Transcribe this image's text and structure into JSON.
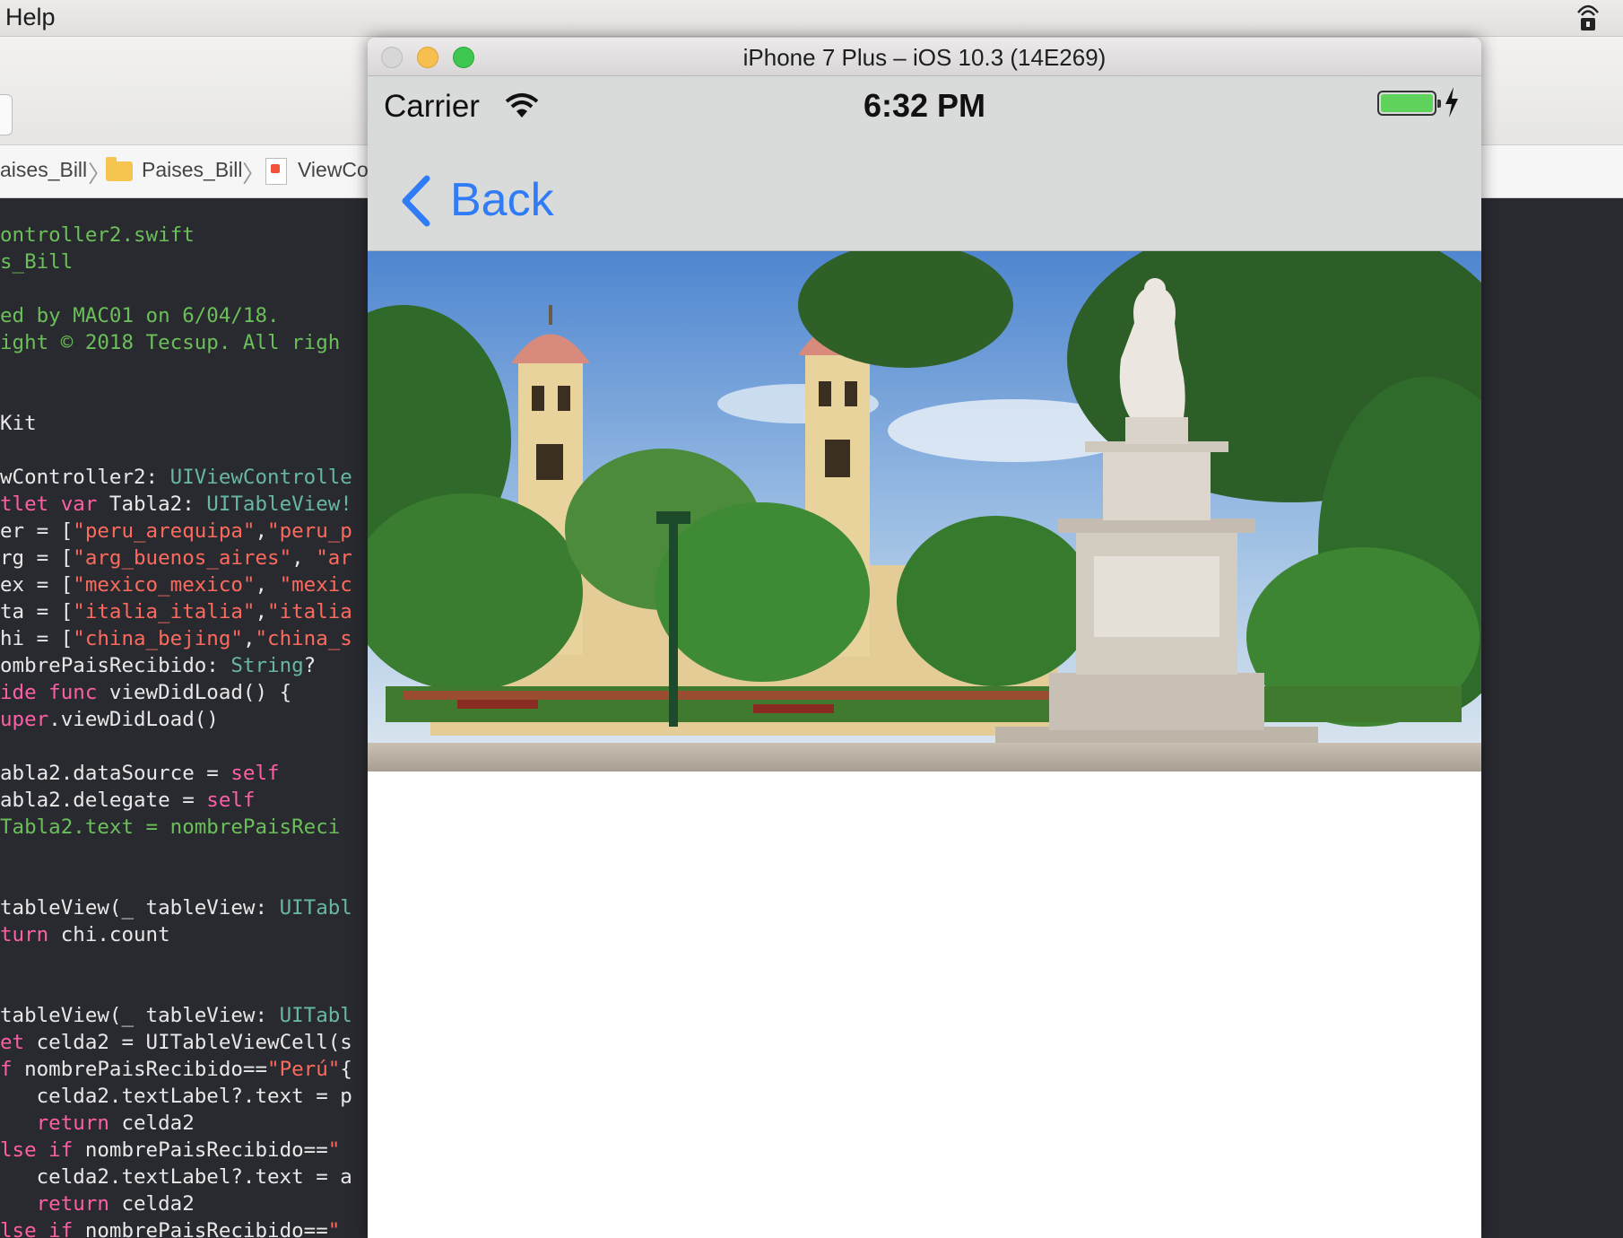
{
  "menubar": {
    "menu_help": "Help",
    "wifi_icon": "airport-status-icon"
  },
  "xcode": {
    "jumpbar": {
      "project": "aises_Bill",
      "group": "Paises_Bill",
      "file": "ViewCo"
    },
    "code_lines": [
      [
        {
          "t": "ontroller2.swift",
          "c": "c-comment"
        }
      ],
      [
        {
          "t": "s_Bill",
          "c": "c-comment"
        }
      ],
      [
        {
          "t": "",
          "c": ""
        }
      ],
      [
        {
          "t": "ed by MAC01 on 6/04/18.",
          "c": "c-comment"
        }
      ],
      [
        {
          "t": "ight © 2018 Tecsup. All righ",
          "c": "c-comment"
        }
      ],
      [
        {
          "t": "",
          "c": ""
        }
      ],
      [
        {
          "t": "",
          "c": ""
        }
      ],
      [
        {
          "t": "Kit",
          "c": ""
        }
      ],
      [
        {
          "t": "",
          "c": ""
        }
      ],
      [
        {
          "t": "wController2: ",
          "c": ""
        },
        {
          "t": "UIViewControlle",
          "c": "c-green"
        }
      ],
      [
        {
          "t": "tlet var ",
          "c": "c-key"
        },
        {
          "t": "Tabla2: ",
          "c": ""
        },
        {
          "t": "UITableView!",
          "c": "c-green"
        }
      ],
      [
        {
          "t": "er = [",
          "c": ""
        },
        {
          "t": "\"peru_arequipa\"",
          "c": "c-str"
        },
        {
          "t": ",",
          "c": ""
        },
        {
          "t": "\"peru_p",
          "c": "c-str"
        }
      ],
      [
        {
          "t": "rg = [",
          "c": ""
        },
        {
          "t": "\"arg_buenos_aires\"",
          "c": "c-str"
        },
        {
          "t": ", ",
          "c": ""
        },
        {
          "t": "\"ar",
          "c": "c-str"
        }
      ],
      [
        {
          "t": "ex = [",
          "c": ""
        },
        {
          "t": "\"mexico_mexico\"",
          "c": "c-str"
        },
        {
          "t": ", ",
          "c": ""
        },
        {
          "t": "\"mexic",
          "c": "c-str"
        }
      ],
      [
        {
          "t": "ta = [",
          "c": ""
        },
        {
          "t": "\"italia_italia\"",
          "c": "c-str"
        },
        {
          "t": ",",
          "c": ""
        },
        {
          "t": "\"italia",
          "c": "c-str"
        }
      ],
      [
        {
          "t": "hi = [",
          "c": ""
        },
        {
          "t": "\"china_bejing\"",
          "c": "c-str"
        },
        {
          "t": ",",
          "c": ""
        },
        {
          "t": "\"china_s",
          "c": "c-str"
        }
      ],
      [
        {
          "t": "ombrePaisRecibido: ",
          "c": ""
        },
        {
          "t": "String",
          "c": "c-green"
        },
        {
          "t": "?",
          "c": ""
        }
      ],
      [
        {
          "t": "ide func ",
          "c": "c-key"
        },
        {
          "t": "viewDidLoad() {",
          "c": ""
        }
      ],
      [
        {
          "t": "uper",
          "c": "c-key"
        },
        {
          "t": ".viewDidLoad()",
          "c": ""
        }
      ],
      [
        {
          "t": "",
          "c": ""
        }
      ],
      [
        {
          "t": "abla2.dataSource = ",
          "c": ""
        },
        {
          "t": "self",
          "c": "c-key"
        }
      ],
      [
        {
          "t": "abla2.delegate = ",
          "c": ""
        },
        {
          "t": "self",
          "c": "c-key"
        }
      ],
      [
        {
          "t": "Tabla2.text = nombrePaisReci",
          "c": "c-comment"
        }
      ],
      [
        {
          "t": "",
          "c": ""
        }
      ],
      [
        {
          "t": "",
          "c": ""
        }
      ],
      [
        {
          "t": "tableView(_ tableView: ",
          "c": ""
        },
        {
          "t": "UITabl",
          "c": "c-green"
        }
      ],
      [
        {
          "t": "turn ",
          "c": "c-key"
        },
        {
          "t": "chi.count",
          "c": ""
        }
      ],
      [
        {
          "t": "",
          "c": ""
        }
      ],
      [
        {
          "t": "",
          "c": ""
        }
      ],
      [
        {
          "t": "tableView(_ tableView: ",
          "c": ""
        },
        {
          "t": "UITabl",
          "c": "c-green"
        }
      ],
      [
        {
          "t": "et ",
          "c": "c-key"
        },
        {
          "t": "celda2 = UITableViewCell(s",
          "c": ""
        }
      ],
      [
        {
          "t": "f ",
          "c": "c-key"
        },
        {
          "t": "nombrePaisRecibido==",
          "c": ""
        },
        {
          "t": "\"Perú\"",
          "c": "c-str"
        },
        {
          "t": "{",
          "c": ""
        }
      ],
      [
        {
          "t": "   celda2.textLabel?.text = p",
          "c": ""
        }
      ],
      [
        {
          "t": "   ",
          "c": ""
        },
        {
          "t": "return ",
          "c": "c-key"
        },
        {
          "t": "celda2",
          "c": ""
        }
      ],
      [
        {
          "t": "lse if ",
          "c": "c-key"
        },
        {
          "t": "nombrePaisRecibido==",
          "c": ""
        },
        {
          "t": "\"",
          "c": "c-str"
        }
      ],
      [
        {
          "t": "   celda2.textLabel?.text = a",
          "c": ""
        }
      ],
      [
        {
          "t": "   ",
          "c": ""
        },
        {
          "t": "return ",
          "c": "c-key"
        },
        {
          "t": "celda2",
          "c": ""
        }
      ],
      [
        {
          "t": "lse if ",
          "c": "c-key"
        },
        {
          "t": "nombrePaisRecibido==",
          "c": ""
        },
        {
          "t": "\"",
          "c": "c-str"
        }
      ]
    ]
  },
  "simulator": {
    "window_title": "iPhone 7 Plus – iOS 10.3 (14E269)",
    "status_bar": {
      "carrier": "Carrier",
      "time": "6:32 PM",
      "battery_level": 1.0,
      "battery_color": "#5ed25b",
      "charging": true
    },
    "navbar": {
      "back_label": "Back",
      "tint": "#2f7cf6"
    },
    "image_description_icon": "city-plaza-photo"
  }
}
